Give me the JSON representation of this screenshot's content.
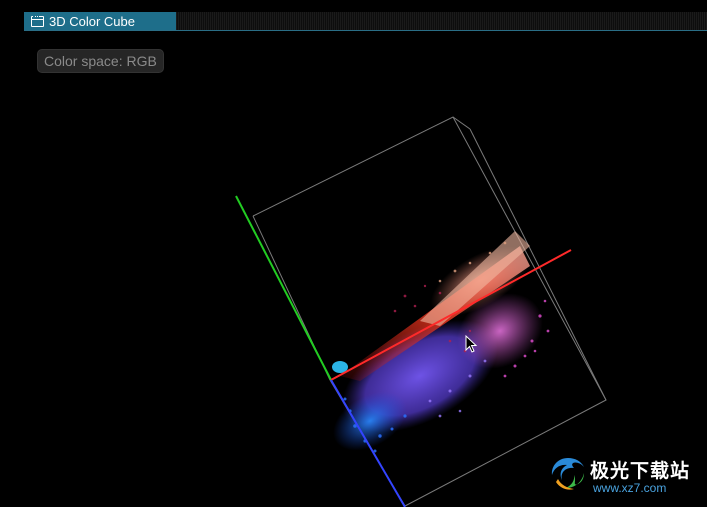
{
  "window": {
    "title": "3D Color Cube",
    "icon": "window-icon"
  },
  "controls": {
    "color_space_label": "Color space: RGB"
  },
  "viewport": {
    "axes": {
      "red_axis_color": "#ff2a2a",
      "green_axis_color": "#22cc22",
      "blue_axis_color": "#3344ff"
    },
    "cube_edge_color": "#7a7a7a"
  },
  "watermark": {
    "logo_text": "极光下载站",
    "url": "www.xz7.com"
  },
  "cursor": "arrow-cursor-icon"
}
